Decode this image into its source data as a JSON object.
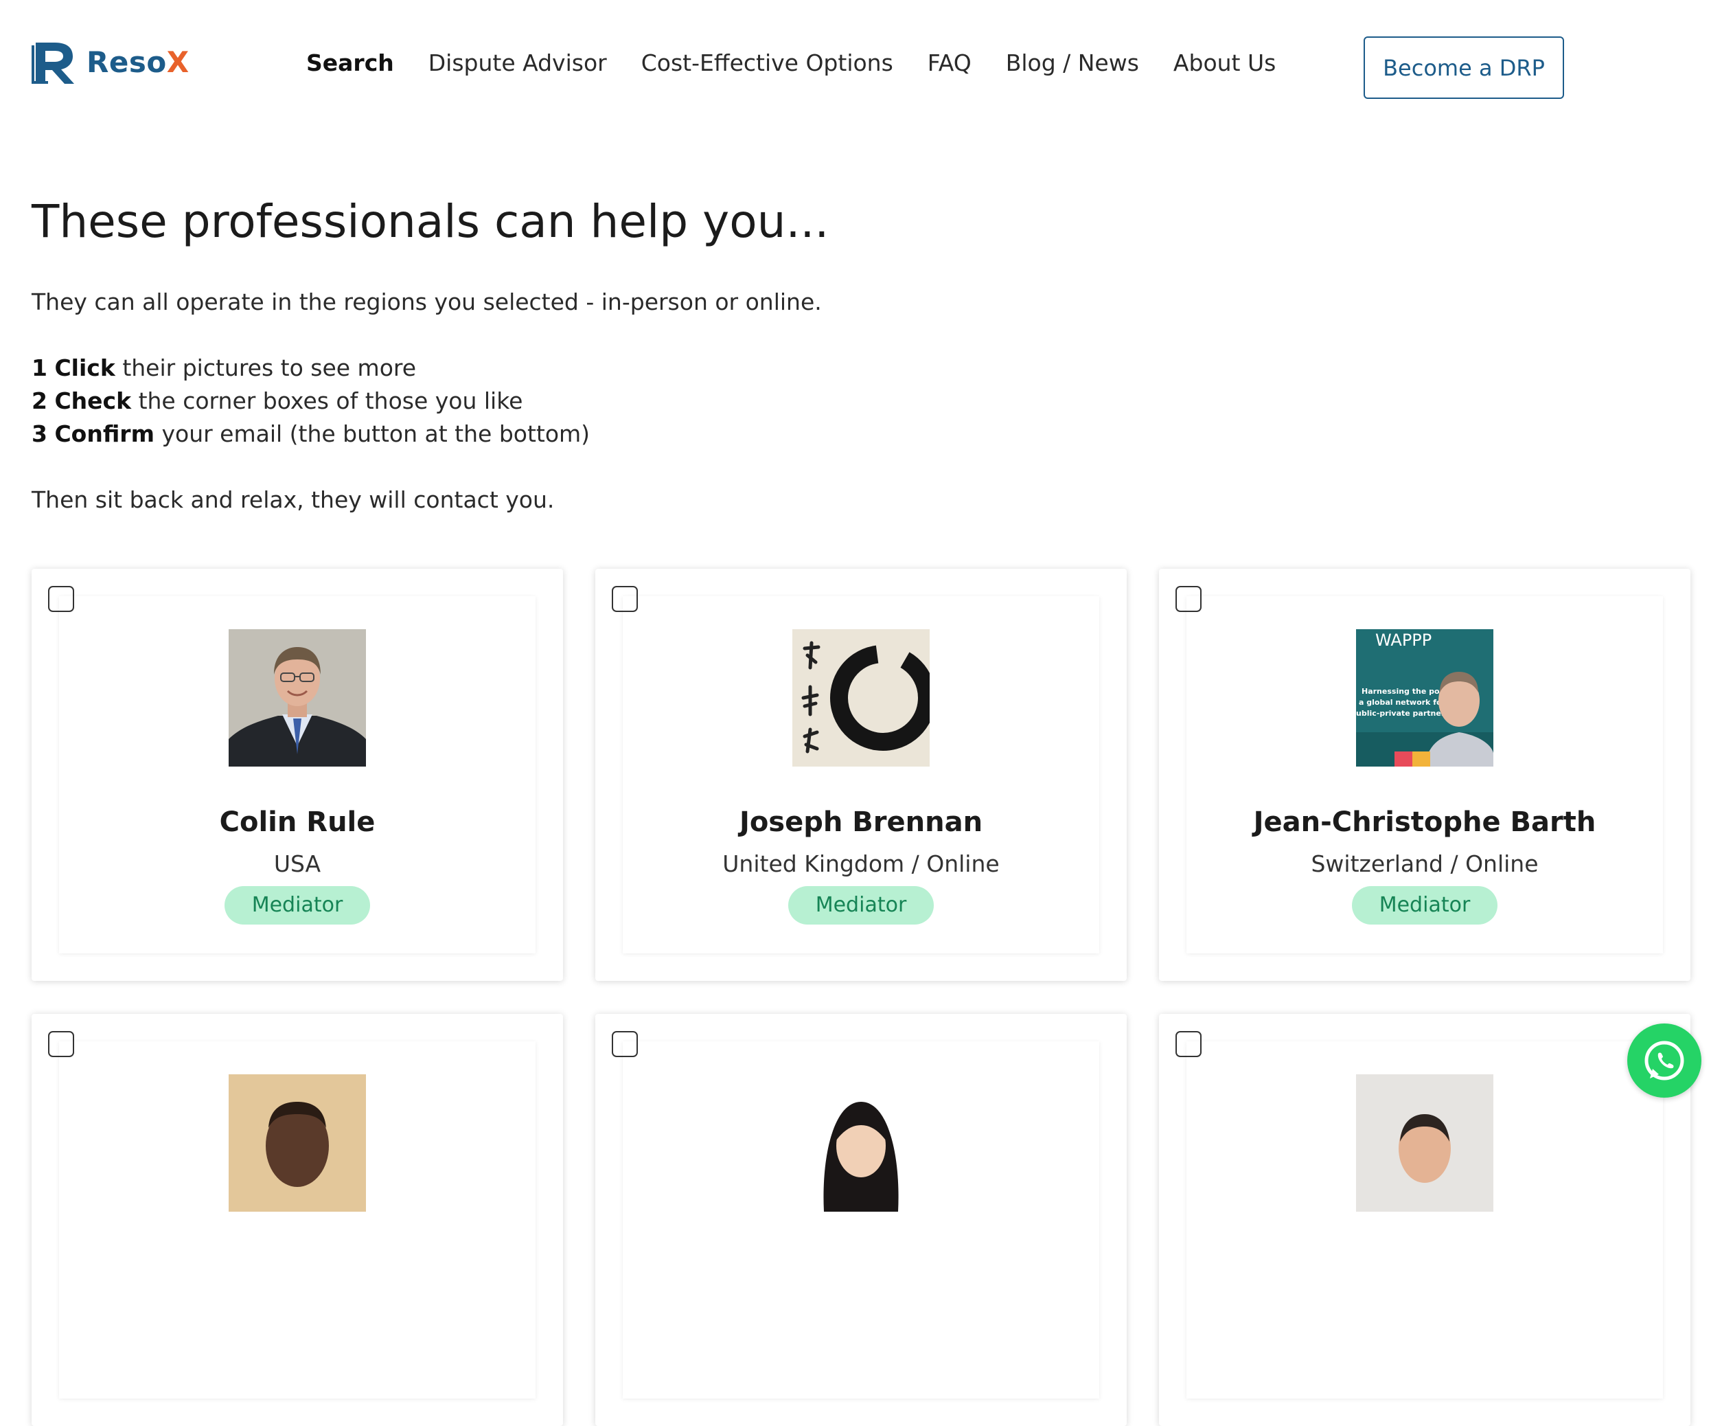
{
  "header": {
    "brand": {
      "part1": "Reso",
      "part2": "X"
    },
    "nav": [
      {
        "label": "Search",
        "active": true
      },
      {
        "label": "Dispute Advisor"
      },
      {
        "label": "Cost-Effective Options"
      },
      {
        "label": "FAQ"
      },
      {
        "label": "Blog / News"
      },
      {
        "label": "About Us"
      }
    ],
    "cta_label": "Become a DRP"
  },
  "intro": {
    "title": "These professionals can help you...",
    "subtitle": "They can all operate in the regions you selected - in-person or online.",
    "steps": [
      {
        "num": "1",
        "verb": "Click",
        "rest": " their pictures to see more"
      },
      {
        "num": "2",
        "verb": "Check",
        "rest": " the corner boxes of those you like"
      },
      {
        "num": "3",
        "verb": "Confirm",
        "rest": " your email (the button at the bottom)"
      }
    ],
    "closing": "Then sit back and relax, they will contact you."
  },
  "professionals": [
    {
      "name": "Colin Rule",
      "location": "USA",
      "role": "Mediator",
      "photo": "portrait-suit"
    },
    {
      "name": "Joseph Brennan",
      "location": "United Kingdom / Online",
      "role": "Mediator",
      "photo": "enso-calligraphy"
    },
    {
      "name": "Jean-Christophe Barth",
      "location": "Switzerland / Online",
      "role": "Mediator",
      "photo": "portrait-banner",
      "banner_title": "WAPPP",
      "banner_lines": [
        "Harnessing the powe",
        "a global network for b",
        "ublic-private partnershi"
      ]
    },
    {
      "name": "",
      "location": "",
      "role": "",
      "photo": "portrait-partial-1"
    },
    {
      "name": "",
      "location": "",
      "role": "",
      "photo": "portrait-partial-2"
    },
    {
      "name": "",
      "location": "",
      "role": "",
      "photo": "portrait-partial-3"
    }
  ],
  "colors": {
    "brand_blue": "#1d5c8a",
    "brand_orange": "#e8622b",
    "badge_bg": "#b7f0d2",
    "badge_text": "#168455",
    "whatsapp": "#25d366"
  },
  "floating": {
    "icon": "whatsapp-icon"
  }
}
